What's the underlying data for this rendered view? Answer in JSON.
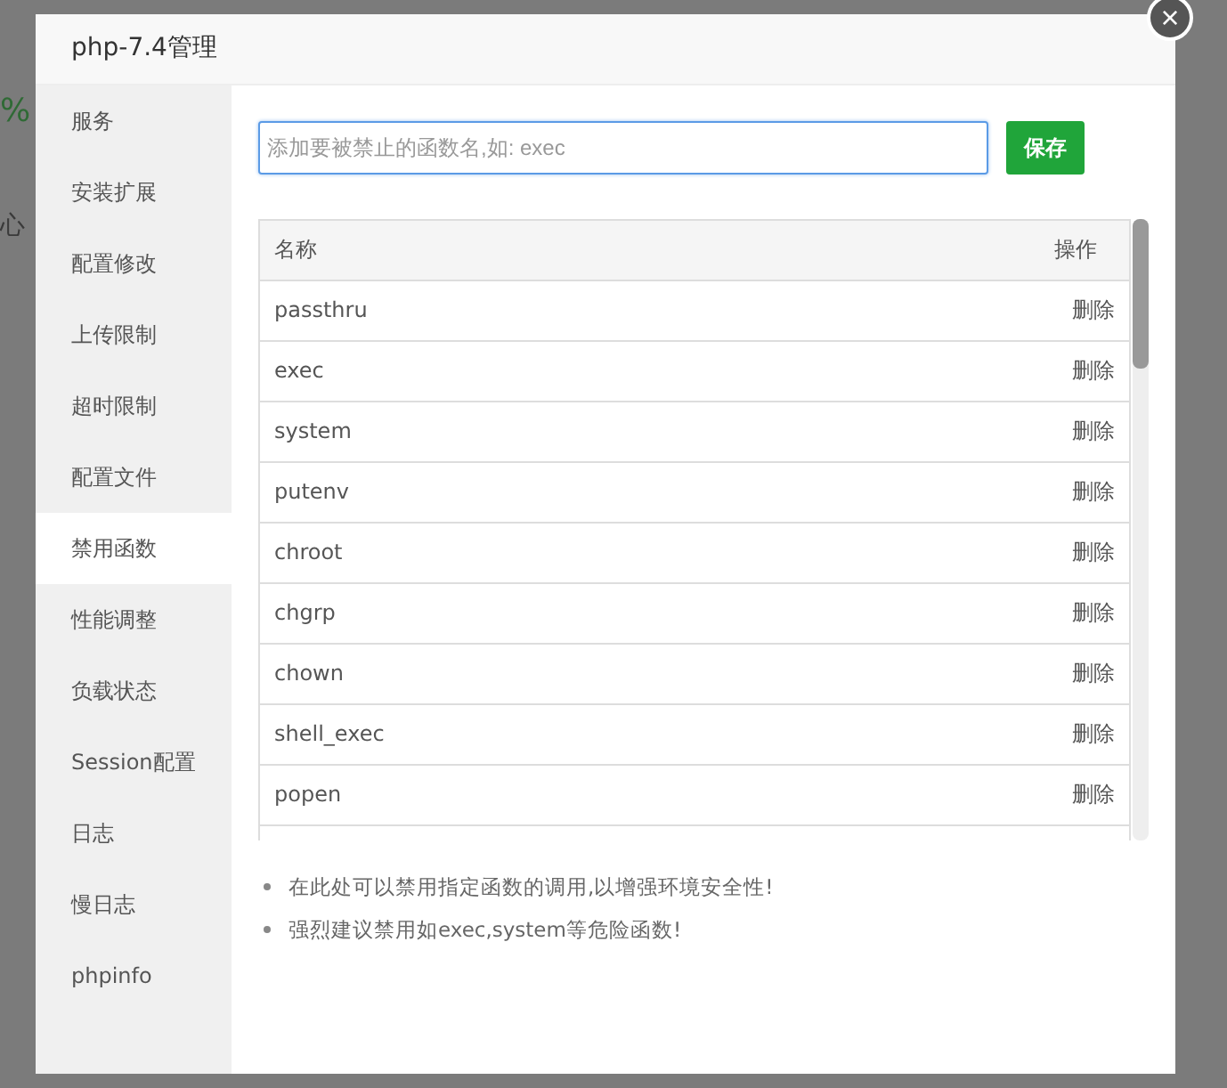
{
  "background": {
    "percent": "%",
    "core_label": "心"
  },
  "dialog": {
    "title": "php-7.4管理",
    "close": "×"
  },
  "sidebar": {
    "items": [
      {
        "label": "服务",
        "selected": false
      },
      {
        "label": "安装扩展",
        "selected": false
      },
      {
        "label": "配置修改",
        "selected": false
      },
      {
        "label": "上传限制",
        "selected": false
      },
      {
        "label": "超时限制",
        "selected": false
      },
      {
        "label": "配置文件",
        "selected": false
      },
      {
        "label": "禁用函数",
        "selected": true
      },
      {
        "label": "性能调整",
        "selected": false
      },
      {
        "label": "负载状态",
        "selected": false
      },
      {
        "label": "Session配置",
        "selected": false
      },
      {
        "label": "日志",
        "selected": false
      },
      {
        "label": "慢日志",
        "selected": false
      },
      {
        "label": "phpinfo",
        "selected": false
      }
    ]
  },
  "add_field": {
    "placeholder": "添加要被禁止的函数名,如: exec"
  },
  "save_button": "保存",
  "table": {
    "columns": [
      "名称",
      "操作"
    ],
    "rows": [
      {
        "name": "passthru",
        "action": "删除"
      },
      {
        "name": "exec",
        "action": "删除"
      },
      {
        "name": "system",
        "action": "删除"
      },
      {
        "name": "putenv",
        "action": "删除"
      },
      {
        "name": "chroot",
        "action": "删除"
      },
      {
        "name": "chgrp",
        "action": "删除"
      },
      {
        "name": "chown",
        "action": "删除"
      },
      {
        "name": "shell_exec",
        "action": "删除"
      },
      {
        "name": "popen",
        "action": "删除"
      }
    ]
  },
  "notes": [
    "在此处可以禁用指定函数的调用,以增强环境安全性!",
    "强烈建议禁用如exec,system等危险函数!"
  ]
}
